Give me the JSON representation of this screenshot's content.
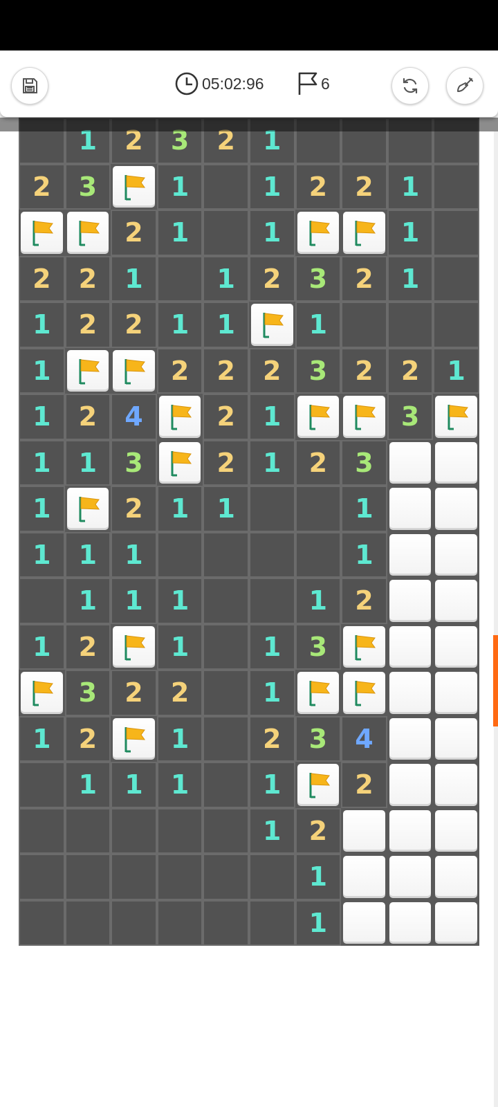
{
  "header": {
    "save_icon": "save-icon",
    "timer": "05:02:96",
    "timer_icon": "clock-icon",
    "flags_count": "6",
    "flags_icon": "flag-outline-icon",
    "restart_icon": "refresh-icon",
    "hint_icon": "shovel-icon"
  },
  "board": {
    "cols": 10,
    "legend": {
      "0": "empty",
      "F": "flag",
      "H": "unrevealed"
    },
    "rows": [
      [
        "0",
        "1",
        "2",
        "3",
        "2",
        "1",
        "0",
        "0",
        "0",
        "0"
      ],
      [
        "2",
        "3",
        "F",
        "1",
        "0",
        "1",
        "2",
        "2",
        "1",
        "0"
      ],
      [
        "F",
        "F",
        "2",
        "1",
        "0",
        "1",
        "F",
        "F",
        "1",
        "0"
      ],
      [
        "2",
        "2",
        "1",
        "0",
        "1",
        "2",
        "3",
        "2",
        "1",
        "0"
      ],
      [
        "1",
        "2",
        "2",
        "1",
        "1",
        "F",
        "1",
        "0",
        "0",
        "0"
      ],
      [
        "1",
        "F",
        "F",
        "2",
        "2",
        "2",
        "3",
        "2",
        "2",
        "1"
      ],
      [
        "1",
        "2",
        "4",
        "F",
        "2",
        "1",
        "F",
        "F",
        "3",
        "F"
      ],
      [
        "1",
        "1",
        "3",
        "F",
        "2",
        "1",
        "2",
        "3",
        "H",
        "H"
      ],
      [
        "1",
        "F",
        "2",
        "1",
        "1",
        "0",
        "0",
        "1",
        "H",
        "H"
      ],
      [
        "1",
        "1",
        "1",
        "0",
        "0",
        "0",
        "0",
        "1",
        "H",
        "H"
      ],
      [
        "0",
        "1",
        "1",
        "1",
        "0",
        "0",
        "1",
        "2",
        "H",
        "H"
      ],
      [
        "1",
        "2",
        "F",
        "1",
        "0",
        "1",
        "3",
        "F",
        "H",
        "H"
      ],
      [
        "F",
        "3",
        "2",
        "2",
        "0",
        "1",
        "F",
        "F",
        "H",
        "H"
      ],
      [
        "1",
        "2",
        "F",
        "1",
        "0",
        "2",
        "3",
        "4",
        "H",
        "H"
      ],
      [
        "0",
        "1",
        "1",
        "1",
        "0",
        "1",
        "F",
        "2",
        "H",
        "H"
      ],
      [
        "0",
        "0",
        "0",
        "0",
        "0",
        "1",
        "2",
        "H",
        "H",
        "H"
      ],
      [
        "0",
        "0",
        "0",
        "0",
        "0",
        "0",
        "1",
        "H",
        "H",
        "H"
      ],
      [
        "0",
        "0",
        "0",
        "0",
        "0",
        "0",
        "1",
        "H",
        "H",
        "H"
      ]
    ]
  },
  "colors": {
    "number_1": "#5ee8d1",
    "number_2": "#f5d27a",
    "number_3": "#a8e878",
    "number_4": "#6fa8ff",
    "flag": "#f7b51a",
    "scrollbar_thumb": "#ff6a13"
  }
}
